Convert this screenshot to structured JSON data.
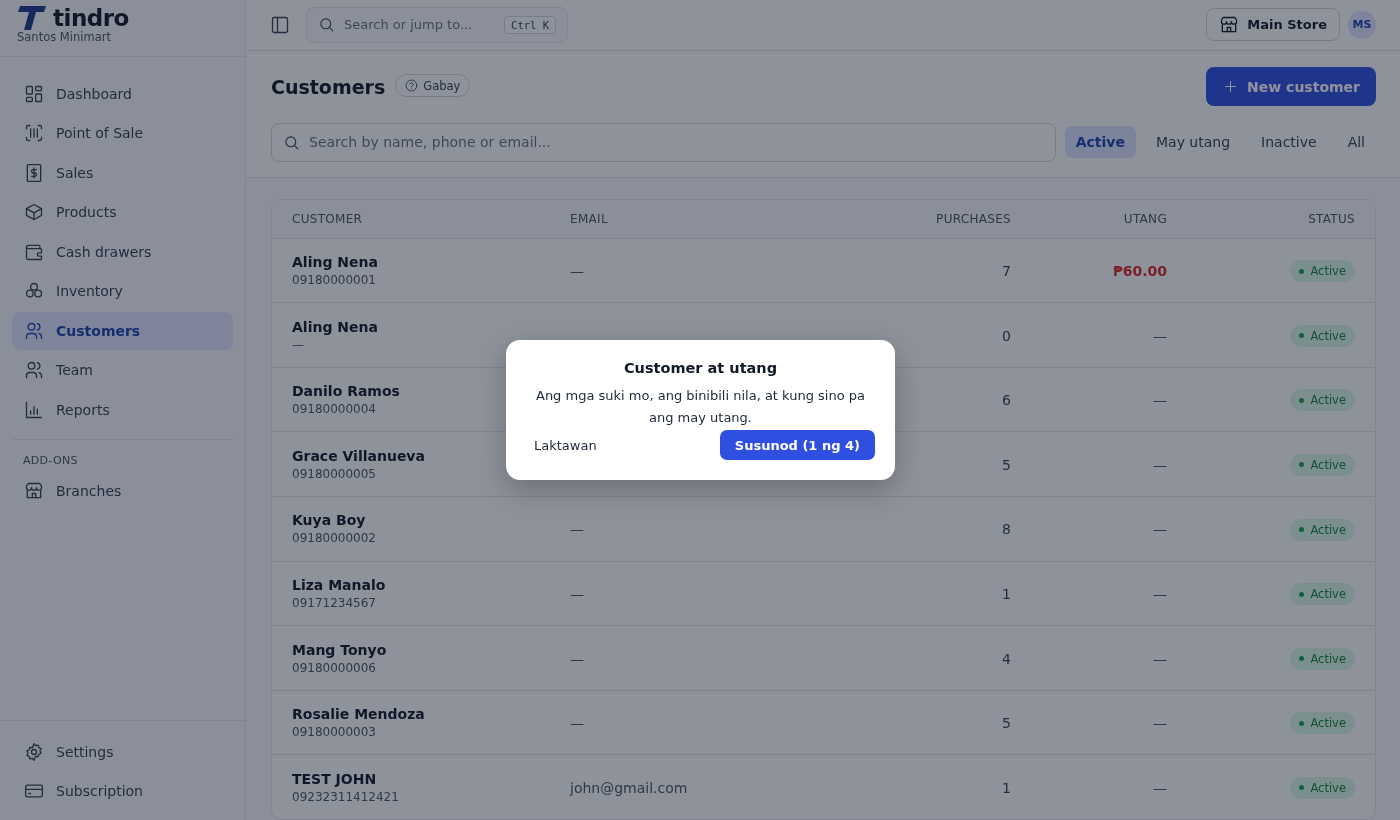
{
  "brand": {
    "name": "tindro",
    "store": "Santos Minimart"
  },
  "sidebar": {
    "items": [
      {
        "label": "Dashboard",
        "selected": false
      },
      {
        "label": "Point of Sale",
        "selected": false
      },
      {
        "label": "Sales",
        "selected": false
      },
      {
        "label": "Products",
        "selected": false
      },
      {
        "label": "Cash drawers",
        "selected": false
      },
      {
        "label": "Inventory",
        "selected": false
      },
      {
        "label": "Customers",
        "selected": true
      },
      {
        "label": "Team",
        "selected": false
      },
      {
        "label": "Reports",
        "selected": false
      }
    ],
    "section": "ADD-ONS",
    "addons": [
      {
        "label": "Branches",
        "selected": false
      }
    ],
    "footer": [
      {
        "label": "Settings"
      },
      {
        "label": "Subscription"
      }
    ]
  },
  "topbar": {
    "search_placeholder": "Search or jump to...",
    "shortcut": "Ctrl K",
    "store_button": "Main Store",
    "avatar": "MS"
  },
  "page": {
    "title": "Customers",
    "help": "Gabay",
    "new_button": "New customer",
    "search_placeholder": "Search by name, phone or email..."
  },
  "filters": [
    {
      "label": "Active",
      "selected": true
    },
    {
      "label": "May utang",
      "selected": false
    },
    {
      "label": "Inactive",
      "selected": false
    },
    {
      "label": "All",
      "selected": false
    }
  ],
  "table": {
    "columns": [
      "CUSTOMER",
      "EMAIL",
      "PURCHASES",
      "UTANG",
      "STATUS"
    ],
    "rows": [
      {
        "name": "Aling Nena",
        "phone": "09180000001",
        "email": "—",
        "purchases": "7",
        "utang": "₱60.00",
        "owed": true,
        "status": "Active"
      },
      {
        "name": "Aling Nena",
        "phone": "—",
        "purchases": "0",
        "utang": "—",
        "owed": false,
        "status": "Active"
      },
      {
        "name": "Danilo Ramos",
        "phone": "09180000004",
        "purchases": "6",
        "utang": "—",
        "owed": false,
        "status": "Active"
      },
      {
        "name": "Grace Villanueva",
        "phone": "09180000005",
        "purchases": "5",
        "utang": "—",
        "owed": false,
        "status": "Active"
      },
      {
        "name": "Kuya Boy",
        "phone": "09180000002",
        "email": "—",
        "purchases": "8",
        "utang": "—",
        "owed": false,
        "status": "Active"
      },
      {
        "name": "Liza Manalo",
        "phone": "09171234567",
        "email": "—",
        "purchases": "1",
        "utang": "—",
        "owed": false,
        "status": "Active"
      },
      {
        "name": "Mang Tonyo",
        "phone": "09180000006",
        "email": "—",
        "purchases": "4",
        "utang": "—",
        "owed": false,
        "status": "Active"
      },
      {
        "name": "Rosalie Mendoza",
        "phone": "09180000003",
        "email": "—",
        "purchases": "5",
        "utang": "—",
        "owed": false,
        "status": "Active"
      },
      {
        "name": "TEST JOHN",
        "phone": "09232311412421",
        "email": "john@gmail.com",
        "purchases": "1",
        "utang": "—",
        "owed": false,
        "status": "Active"
      }
    ]
  },
  "dialog": {
    "title": "Customer at utang",
    "body": "Ang mga suki mo, ang binibili nila, at kung sino pa ang may utang.",
    "skip": "Laktawan",
    "next": "Susunod (1 ng 4)"
  }
}
